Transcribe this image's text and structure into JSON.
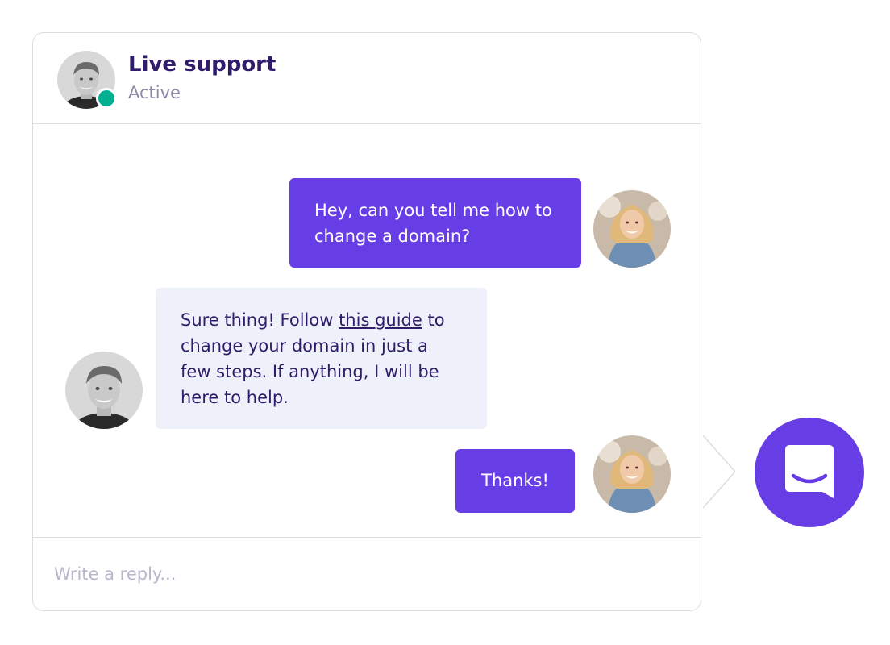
{
  "header": {
    "title": "Live support",
    "status": "Active"
  },
  "messages": [
    {
      "from": "user",
      "text": "Hey, can you tell me how to change a domain?"
    },
    {
      "from": "agent",
      "text_before": "Sure thing! Follow ",
      "link_text": "this guide",
      "text_after": " to change your domain in just a few steps. If anything, I will be here to help."
    },
    {
      "from": "user",
      "text": "Thanks!"
    }
  ],
  "composer": {
    "placeholder": "Write a reply..."
  },
  "icons": {
    "launcher": "chat-bubble-smile-icon",
    "status": "online-dot"
  },
  "colors": {
    "brand": "#673de6",
    "online": "#00b090",
    "title": "#2f1c6a",
    "incoming_bubble": "#eff1fa"
  }
}
